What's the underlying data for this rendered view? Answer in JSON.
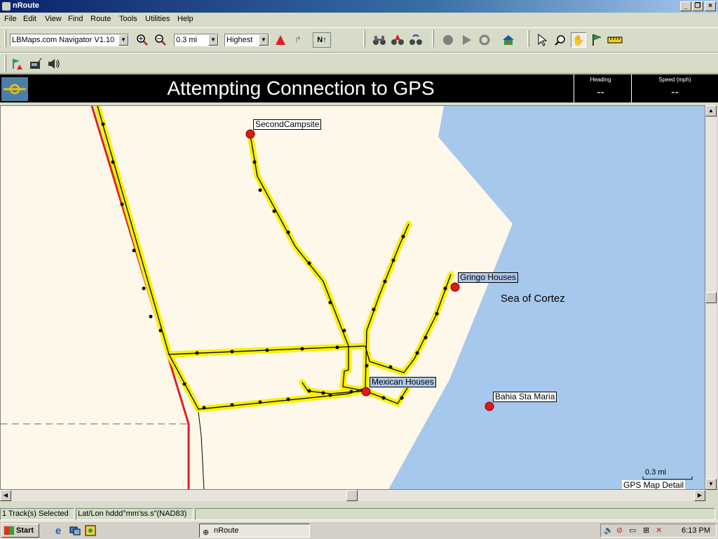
{
  "window": {
    "title": "nRoute"
  },
  "menu": [
    "File",
    "Edit",
    "View",
    "Find",
    "Route",
    "Tools",
    "Utilities",
    "Help"
  ],
  "toolbar": {
    "map_select": "LBMaps.com Navigator V1.10",
    "zoom_level": "0.3 mi",
    "detail_level": "Highest",
    "north_label": "N↑"
  },
  "gps": {
    "status": "Attempting Connection to GPS",
    "heading_label": "Heading",
    "heading_value": "--",
    "speed_label": "Speed (mph)",
    "speed_value": "--"
  },
  "map": {
    "water_label": "Sea of Cortez",
    "waypoints": [
      "SecondCampsite",
      "Gringo Houses",
      "Mexican Houses",
      "Bahia Sta Maria"
    ],
    "scale_label": "0.3 mi",
    "detail_label": "GPS Map Detail"
  },
  "status": {
    "selection": "1 Track(s) Selected",
    "coord_format": "Lat/Lon hddd°mm'ss.s\"(NAD83)"
  },
  "taskbar": {
    "start": "Start",
    "task": "nRoute",
    "clock": "6:13 PM"
  }
}
